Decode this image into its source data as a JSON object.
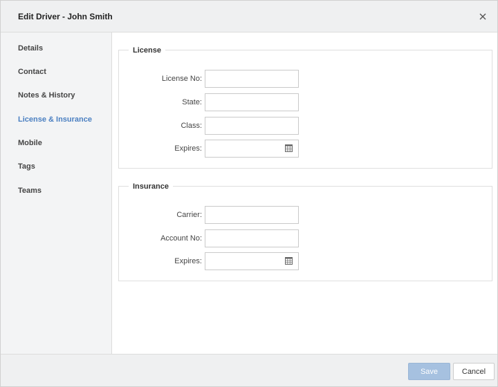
{
  "dialog": {
    "title": "Edit Driver - John Smith",
    "close_icon": "close-icon"
  },
  "sidebar": {
    "items": [
      {
        "label": "Details",
        "active": false
      },
      {
        "label": "Contact",
        "active": false
      },
      {
        "label": "Notes & History",
        "active": false
      },
      {
        "label": "License & Insurance",
        "active": true
      },
      {
        "label": "Mobile",
        "active": false
      },
      {
        "label": "Tags",
        "active": false
      },
      {
        "label": "Teams",
        "active": false
      }
    ]
  },
  "license": {
    "legend": "License",
    "license_no_label": "License No:",
    "license_no_value": "",
    "state_label": "State:",
    "state_value": "",
    "class_label": "Class:",
    "class_value": "",
    "expires_label": "Expires:",
    "expires_value": "",
    "calendar_icon": "calendar-icon"
  },
  "insurance": {
    "legend": "Insurance",
    "carrier_label": "Carrier:",
    "carrier_value": "",
    "account_no_label": "Account No:",
    "account_no_value": "",
    "expires_label": "Expires:",
    "expires_value": "",
    "calendar_icon": "calendar-icon"
  },
  "footer": {
    "save_label": "Save",
    "cancel_label": "Cancel"
  },
  "colors": {
    "active_nav": "#4a7fc1",
    "save_button_disabled": "#a6c1e0",
    "header_background": "#eff0f1"
  }
}
